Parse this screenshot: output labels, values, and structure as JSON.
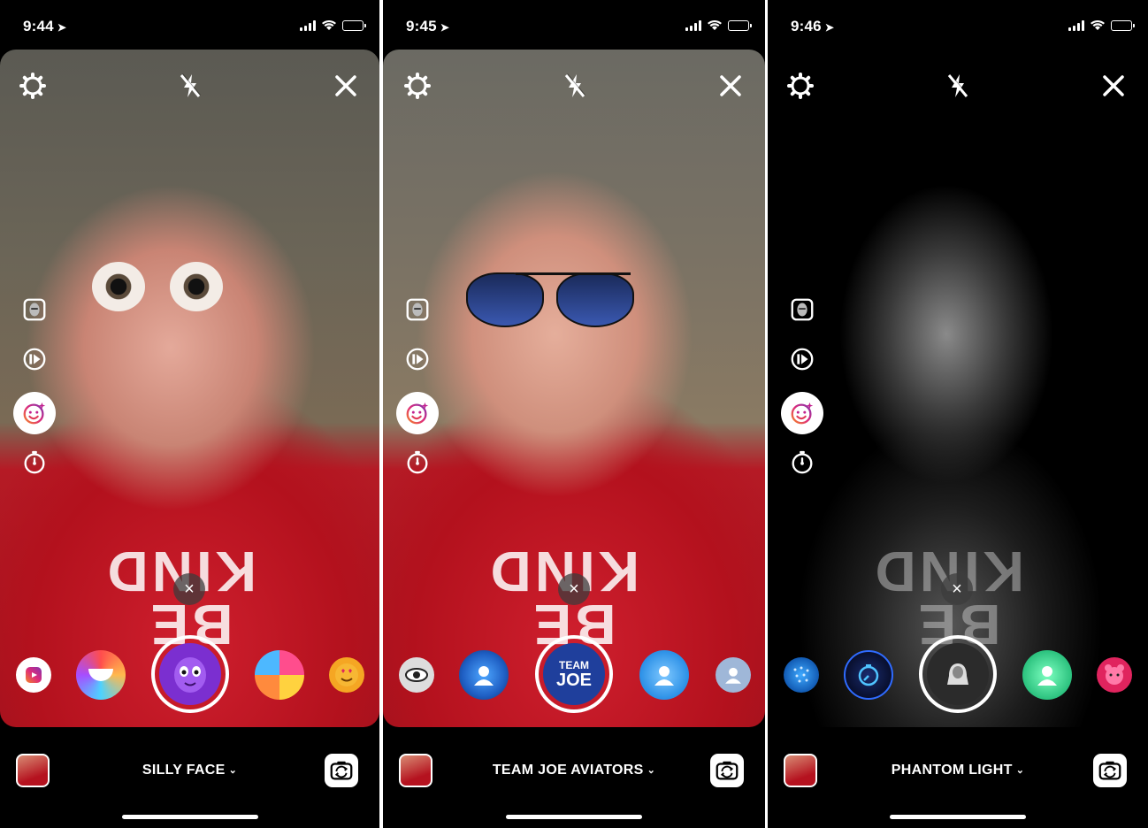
{
  "panels": [
    {
      "status_time": "9:44",
      "effect_name": "SILLY FACE",
      "colors": {
        "selected_effect": "#7b2fd0"
      }
    },
    {
      "status_time": "9:45",
      "effect_name": "TEAM JOE AVIATORS",
      "selected_effect_text_top": "TEAM",
      "selected_effect_text_bottom": "JOE",
      "colors": {
        "selected_effect": "#1f3f9c"
      }
    },
    {
      "status_time": "9:46",
      "effect_name": "PHANTOM LIGHT",
      "colors": {
        "selected_effect": "#2b2b2b"
      }
    }
  ],
  "shirt_text": "BE KIND",
  "dismiss_glyph": "×",
  "chevron_glyph": "⌄",
  "location_glyph": "➤",
  "icons": [
    "settings-icon",
    "flash-off-icon",
    "close-icon",
    "face-filter-icon",
    "boomerang-icon",
    "effects-icon",
    "timer-icon",
    "gallery-thumbnail",
    "flip-camera-icon",
    "reels-icon"
  ]
}
